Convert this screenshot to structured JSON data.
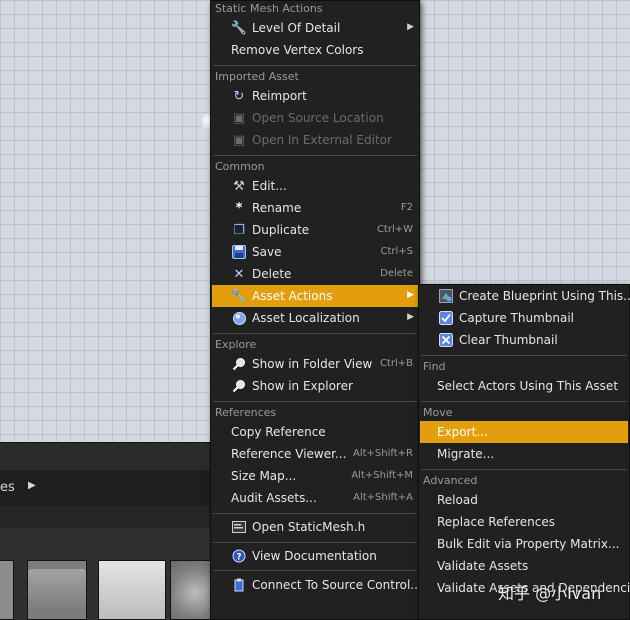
{
  "content_browser": {
    "path_text": "es"
  },
  "context_menu": {
    "sections": {
      "static_mesh_actions": "Static Mesh Actions",
      "imported_asset": "Imported Asset",
      "common": "Common",
      "explore": "Explore",
      "references": "References"
    },
    "items": {
      "level_of_detail": "Level Of Detail",
      "remove_vertex_colors": "Remove Vertex Colors",
      "reimport": "Reimport",
      "open_source_location": "Open Source Location",
      "open_in_external_editor": "Open In External Editor",
      "edit": "Edit...",
      "rename": "Rename",
      "duplicate": "Duplicate",
      "save": "Save",
      "delete": "Delete",
      "asset_actions": "Asset Actions",
      "asset_localization": "Asset Localization",
      "show_in_folder_view": "Show in Folder View",
      "show_in_explorer": "Show in Explorer",
      "copy_reference": "Copy Reference",
      "reference_viewer": "Reference Viewer...",
      "size_map": "Size Map...",
      "audit_assets": "Audit Assets...",
      "open_staticmesh_h": "Open StaticMesh.h",
      "view_documentation": "View Documentation",
      "connect_to_source_control": "Connect To Source Control..."
    },
    "shortcuts": {
      "rename": "F2",
      "duplicate": "Ctrl+W",
      "save": "Ctrl+S",
      "delete": "Delete",
      "show_in_folder_view": "Ctrl+B",
      "reference_viewer": "Alt+Shift+R",
      "size_map": "Alt+Shift+M",
      "audit_assets": "Alt+Shift+A"
    }
  },
  "submenu": {
    "sections": {
      "find": "Find",
      "move": "Move",
      "advanced": "Advanced"
    },
    "items": {
      "create_blueprint": "Create Blueprint Using This...",
      "capture_thumbnail": "Capture Thumbnail",
      "clear_thumbnail": "Clear Thumbnail",
      "select_actors": "Select Actors Using This Asset",
      "export": "Export...",
      "migrate": "Migrate...",
      "reload": "Reload",
      "replace_references": "Replace References",
      "bulk_edit": "Bulk Edit via Property Matrix...",
      "validate_assets": "Validate Assets",
      "validate_assets_deps": "Validate Assets and Dependencies"
    }
  },
  "watermark": "知乎 @小Ivan",
  "colors": {
    "highlight": "#e29e0c",
    "menu_bg": "#212121",
    "viewport_bg": "#d5d9e1"
  },
  "icons": {
    "level_of_detail": "wrench-icon",
    "reimport": "reimport-icon",
    "open_source_location": "folder-location-icon",
    "open_in_external_editor": "external-editor-icon",
    "edit": "hammer-icon",
    "rename": "asterisk-icon",
    "duplicate": "duplicate-icon",
    "save": "floppy-disk-icon",
    "delete": "x-icon",
    "asset_actions": "wrench-icon",
    "asset_localization": "globe-icon",
    "show_in_folder_view": "magnifier-icon",
    "show_in_explorer": "magnifier-icon",
    "open_staticmesh_h": "code-file-icon",
    "view_documentation": "help-icon",
    "connect_to_source_control": "source-control-icon",
    "create_blueprint": "blueprint-icon",
    "capture_thumbnail": "checkbox-icon",
    "clear_thumbnail": "clear-x-icon"
  }
}
